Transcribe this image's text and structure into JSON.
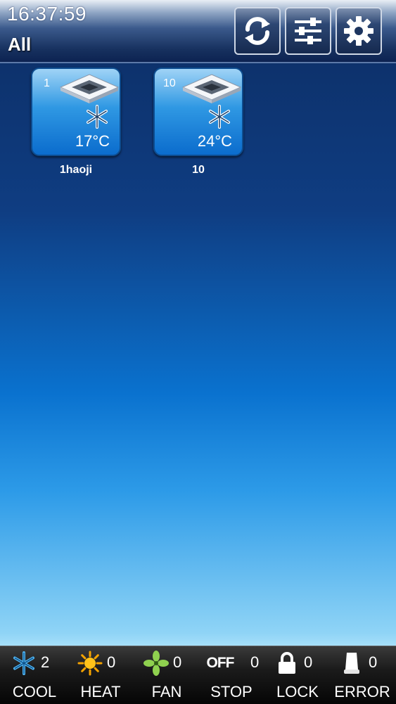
{
  "header": {
    "time": "16:37:59",
    "group": "All",
    "buttons": [
      {
        "icon": "refresh-icon"
      },
      {
        "icon": "sliders-icon"
      },
      {
        "icon": "gear-icon"
      }
    ]
  },
  "devices": [
    {
      "number": "1",
      "temperature": "17°C",
      "name": "1haoji",
      "mode_icon": "snowflake-icon",
      "unit_icon": "cassette-ac-icon"
    },
    {
      "number": "10",
      "temperature": "24°C",
      "name": "10",
      "mode_icon": "snowflake-icon",
      "unit_icon": "cassette-ac-icon"
    }
  ],
  "footer": {
    "cool": {
      "count": "2",
      "label": "COOL",
      "icon": "snowflake-icon"
    },
    "heat": {
      "count": "0",
      "label": "HEAT",
      "icon": "sun-icon"
    },
    "fan": {
      "count": "0",
      "label": "FAN",
      "icon": "fan-icon"
    },
    "stop": {
      "count": "0",
      "label": "STOP",
      "icon_text": "OFF"
    },
    "lock": {
      "count": "0",
      "label": "LOCK",
      "icon": "lock-icon"
    },
    "error": {
      "count": "0",
      "label": "ERROR",
      "icon": "error-icon"
    }
  },
  "colors": {
    "tile_blue": "#2f98e3",
    "cool_blue": "#4fb3f0",
    "heat_orange": "#f5a300",
    "fan_green": "#8fd14f"
  }
}
